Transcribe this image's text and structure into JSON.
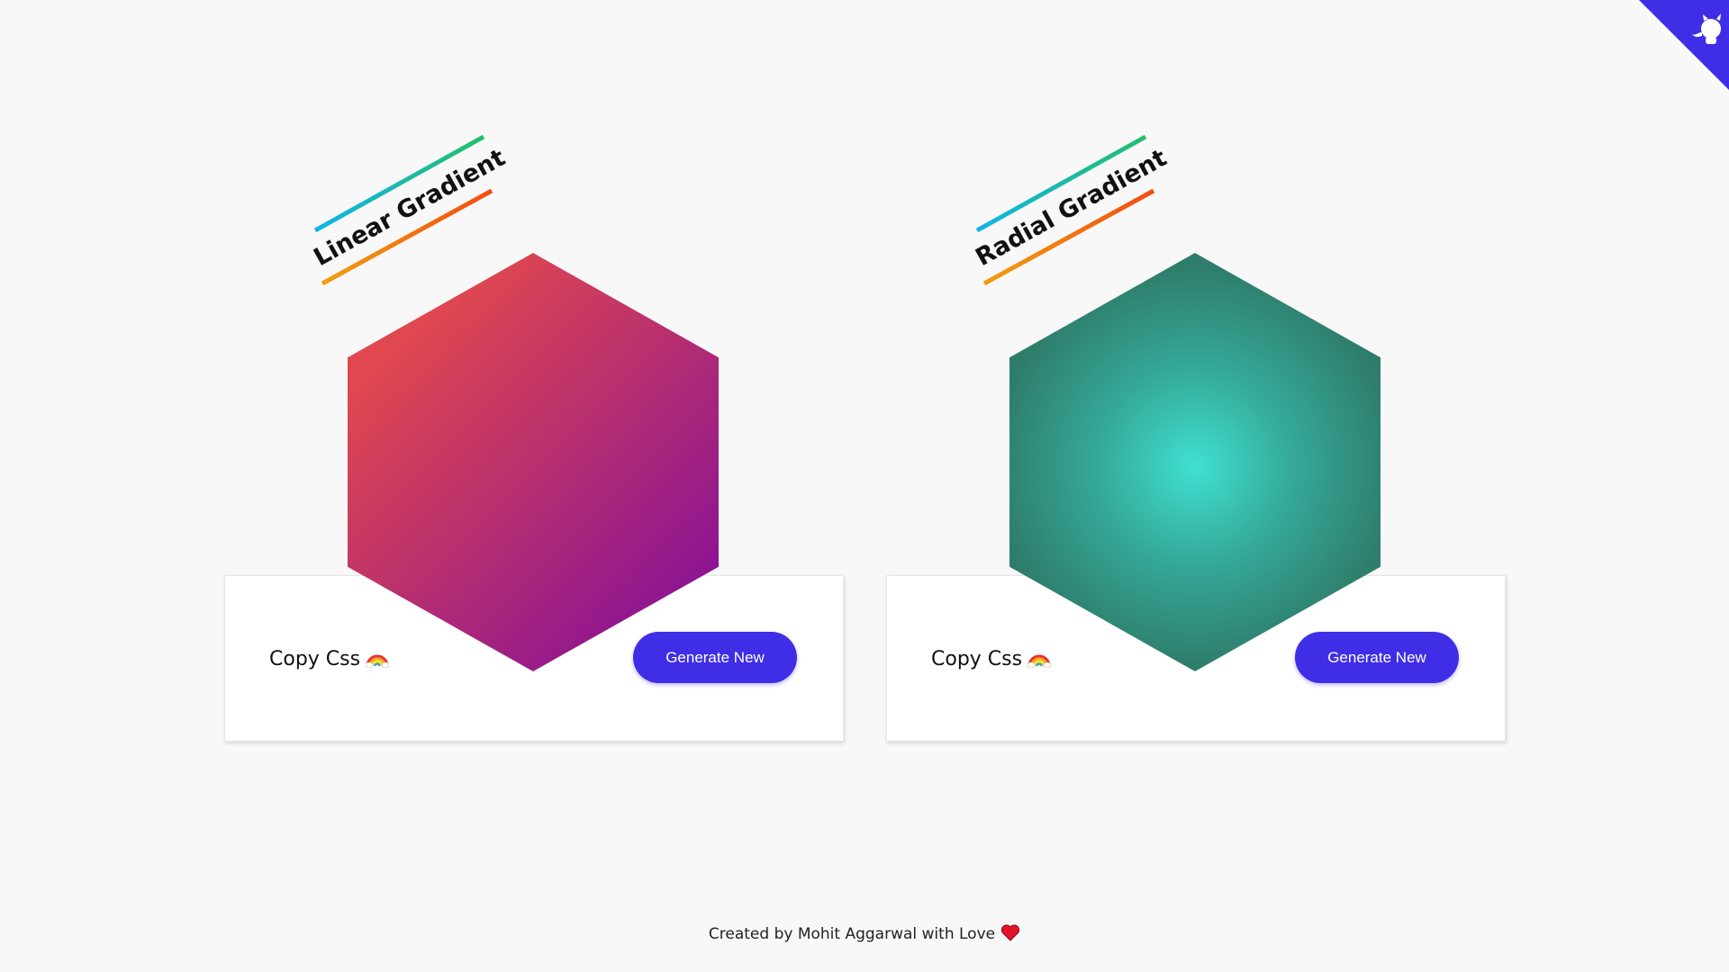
{
  "github_corner": {
    "icon": "github-octocat-icon",
    "color": "#3f2ee6"
  },
  "cards": [
    {
      "title": "Linear Gradient",
      "gradient_type": "linear",
      "colors": [
        "#e0474f",
        "#7d0aa0"
      ],
      "copy_label": "Copy Css",
      "copy_icon": "rainbow-icon",
      "button_label": "Generate New"
    },
    {
      "title": "Radial Gradient",
      "gradient_type": "radial",
      "colors": [
        "#40e0d0",
        "#2a6c5a"
      ],
      "copy_label": "Copy Css",
      "copy_icon": "rainbow-icon",
      "button_label": "Generate New"
    }
  ],
  "footer": {
    "text": "Created by Mohit Aggarwal with Love",
    "icon": "heart-icon"
  },
  "accent_color": "#3f2ee6"
}
